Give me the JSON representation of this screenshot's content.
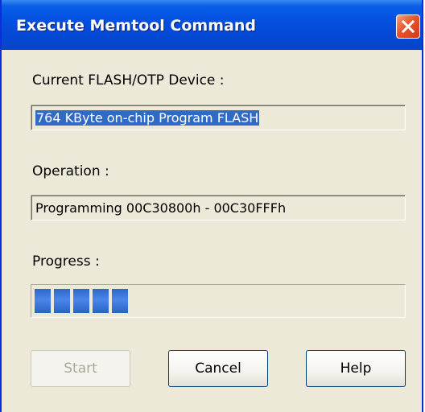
{
  "window": {
    "title": "Execute Memtool Command"
  },
  "device": {
    "label": "Current FLASH/OTP Device :",
    "value": "764 KByte on-chip Program FLASH"
  },
  "operation": {
    "label": "Operation :",
    "value": "Programming 00C30800h - 00C30FFFh"
  },
  "progress": {
    "label": "Progress :",
    "fraction": 0.26
  },
  "buttons": {
    "start": "Start",
    "cancel": "Cancel",
    "help": "Help"
  },
  "colors": {
    "titlebar": "#0450e0",
    "selection": "#316ac5",
    "progress_fill": "#3a78dc",
    "close_button": "#e6552d"
  }
}
